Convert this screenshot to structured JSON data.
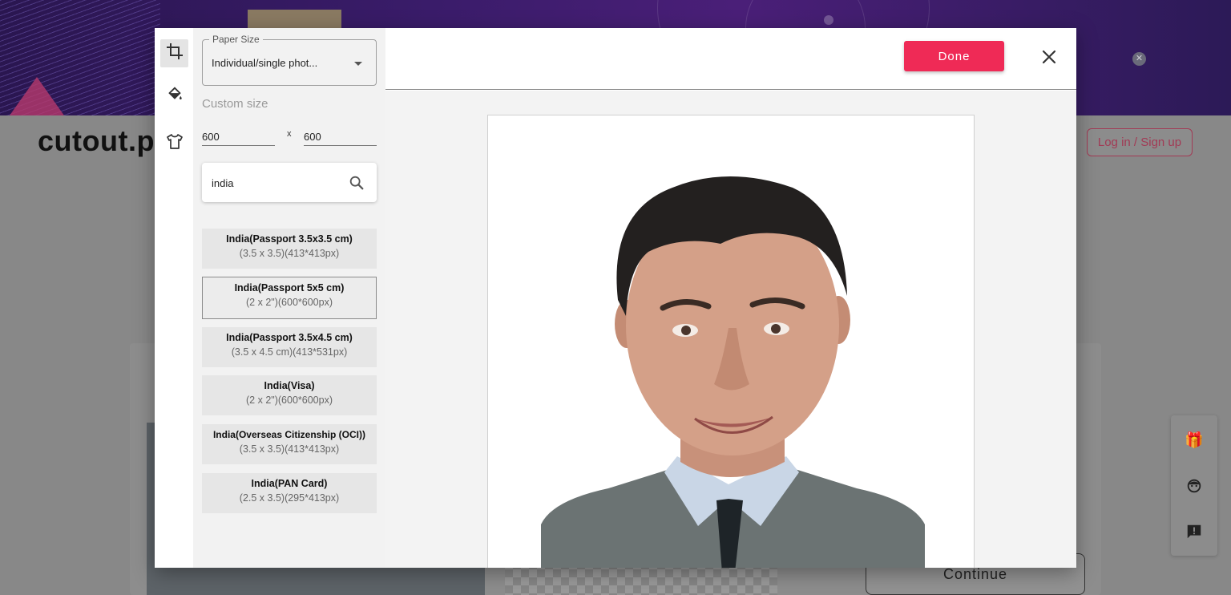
{
  "background": {
    "logo_text": "cutout.p",
    "login_label": "Log in / Sign up",
    "continue_label": "Continue",
    "fab_icons": [
      "gift-icon",
      "support-agent-icon",
      "feedback-icon"
    ]
  },
  "sidebar_tools": [
    {
      "name": "crop-icon",
      "active": true
    },
    {
      "name": "paint-bucket-icon",
      "active": false
    },
    {
      "name": "tshirt-icon",
      "active": false
    }
  ],
  "panel": {
    "paper_size_label": "Paper Size",
    "paper_size_value": "Individual/single phot...",
    "custom_size_label": "Custom size",
    "width_value": "600",
    "height_value": "600",
    "size_separator": "x",
    "search_value": "india",
    "presets": [
      {
        "name": "India(Passport 3.5x3.5 cm)",
        "dims": "(3.5 x 3.5)(413*413px)",
        "selected": false
      },
      {
        "name": "India(Passport 5x5 cm)",
        "dims": "(2 x 2\")(600*600px)",
        "selected": true
      },
      {
        "name": "India(Passport 3.5x4.5 cm)",
        "dims": "(3.5 x 4.5 cm)(413*531px)",
        "selected": false
      },
      {
        "name": "India(Visa)",
        "dims": "(2 x 2\")(600*600px)",
        "selected": false
      },
      {
        "name": "India(Overseas Citizenship (OCI))",
        "dims": "(3.5 x 3.5)(413*413px)",
        "selected": false
      },
      {
        "name": "India(PAN Card)",
        "dims": "(2.5 x 3.5)(295*413px)",
        "selected": false
      }
    ]
  },
  "toolbar": {
    "done_label": "Done"
  },
  "colors": {
    "accent": "#ef2a56",
    "panel_bg": "#f2f2f2",
    "preset_bg": "#e6e6e6"
  }
}
